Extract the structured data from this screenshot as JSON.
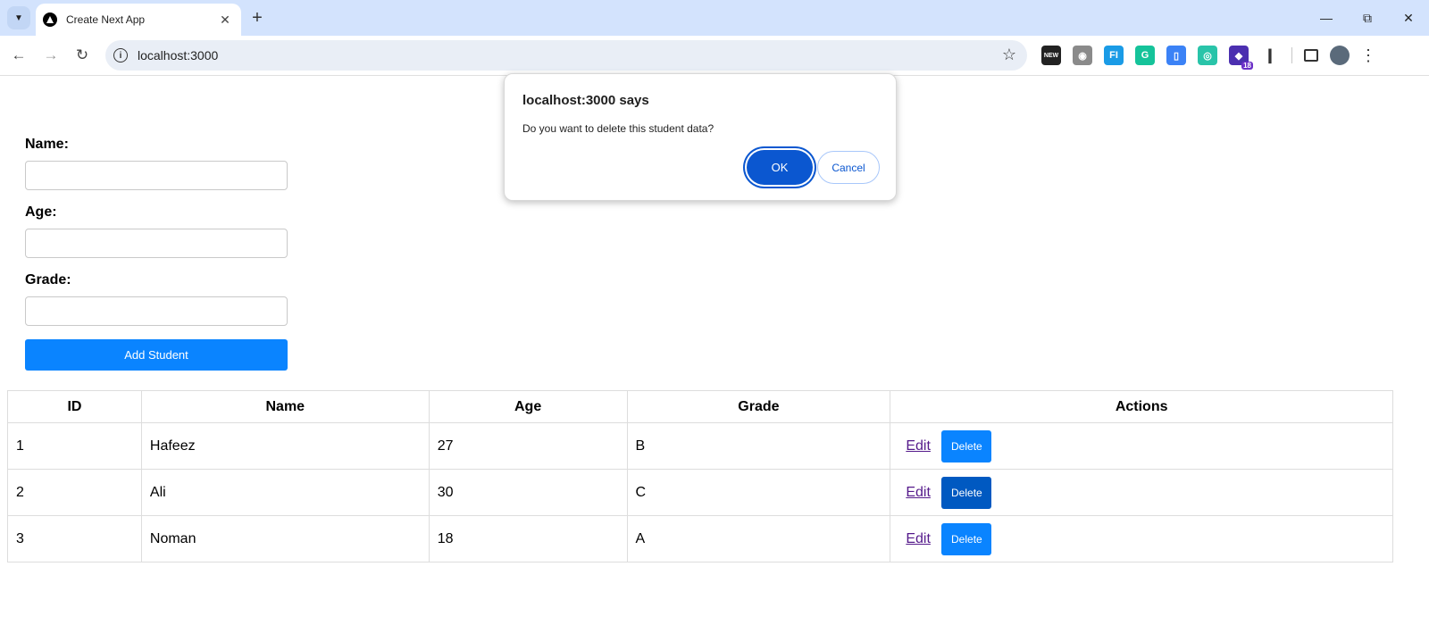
{
  "browser": {
    "tab_title": "Create Next App",
    "url": "localhost:3000",
    "extensions": [
      {
        "name": "new-extension-icon",
        "label": "NEW",
        "color": "#222222"
      },
      {
        "name": "camera-extension-icon",
        "label": "◉",
        "color": "#8a8a8a"
      },
      {
        "name": "fi-extension-icon",
        "label": "FI",
        "color": "#1a9be6"
      },
      {
        "name": "grammarly-extension-icon",
        "label": "G",
        "color": "#15c39a"
      },
      {
        "name": "phone-extension-icon",
        "label": "▯",
        "color": "#3b82f6"
      },
      {
        "name": "target-extension-icon",
        "label": "◎",
        "color": "#29c4a9"
      },
      {
        "name": "learning-extension-icon",
        "label": "◆",
        "color": "#4b2fb0",
        "badge": "18"
      }
    ]
  },
  "form": {
    "name_label": "Name:",
    "age_label": "Age:",
    "grade_label": "Grade:",
    "name_value": "",
    "age_value": "",
    "grade_value": "",
    "add_button": "Add Student"
  },
  "table": {
    "headers": [
      "ID",
      "Name",
      "Age",
      "Grade",
      "Actions"
    ],
    "rows": [
      {
        "id": "1",
        "name": "Hafeez",
        "age": "27",
        "grade": "B"
      },
      {
        "id": "2",
        "name": "Ali",
        "age": "30",
        "grade": "C"
      },
      {
        "id": "3",
        "name": "Noman",
        "age": "18",
        "grade": "A"
      }
    ],
    "edit_label": "Edit",
    "delete_label": "Delete"
  },
  "dialog": {
    "title": "localhost:3000 says",
    "message": "Do you want to delete this student data?",
    "ok_label": "OK",
    "cancel_label": "Cancel"
  },
  "colors": {
    "primary_button": "#0a84ff",
    "delete_hover": "#0059c1",
    "dialog_ok": "#0b57d0",
    "tabbar": "#d3e3fd"
  }
}
